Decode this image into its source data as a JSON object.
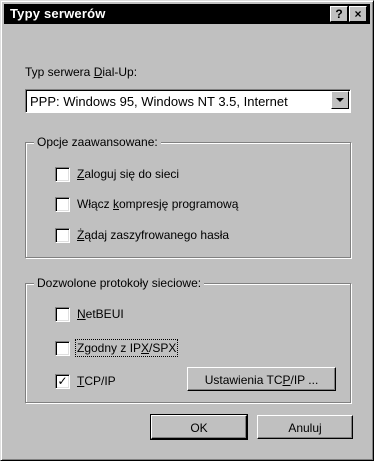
{
  "window": {
    "title": "Typy serwerów",
    "help_btn": "?",
    "close_btn": "×"
  },
  "dialup": {
    "label_pre": "Typ serwera ",
    "label_u": "D",
    "label_post": "ial-Up:",
    "selected": "PPP: Windows 95, Windows NT 3.5, Internet"
  },
  "advanced": {
    "legend": "Opcje zaawansowane:",
    "options": [
      {
        "pre": "",
        "u": "Z",
        "post": "aloguj się do sieci",
        "checked": false
      },
      {
        "pre": "Włącz ",
        "u": "k",
        "post": "ompresję programową",
        "checked": false
      },
      {
        "pre": "",
        "u": "Ż",
        "post": "ądaj zaszyfrowanego hasła",
        "checked": false
      }
    ]
  },
  "protocols": {
    "legend": "Dozwolone protokoły sieciowe:",
    "options": [
      {
        "pre": "",
        "u": "N",
        "post": "etBEUI",
        "checked": false
      },
      {
        "pre": "Zgodny z IP",
        "u": "X",
        "post": "/SPX",
        "checked": false
      },
      {
        "pre": "",
        "u": "T",
        "post": "CP/IP",
        "checked": true
      }
    ],
    "tcpip_settings_pre": "Ustawienia TC",
    "tcpip_settings_u": "P",
    "tcpip_settings_post": "/IP ..."
  },
  "buttons": {
    "ok": "OK",
    "cancel": "Anuluj"
  },
  "check_mark": "✓"
}
